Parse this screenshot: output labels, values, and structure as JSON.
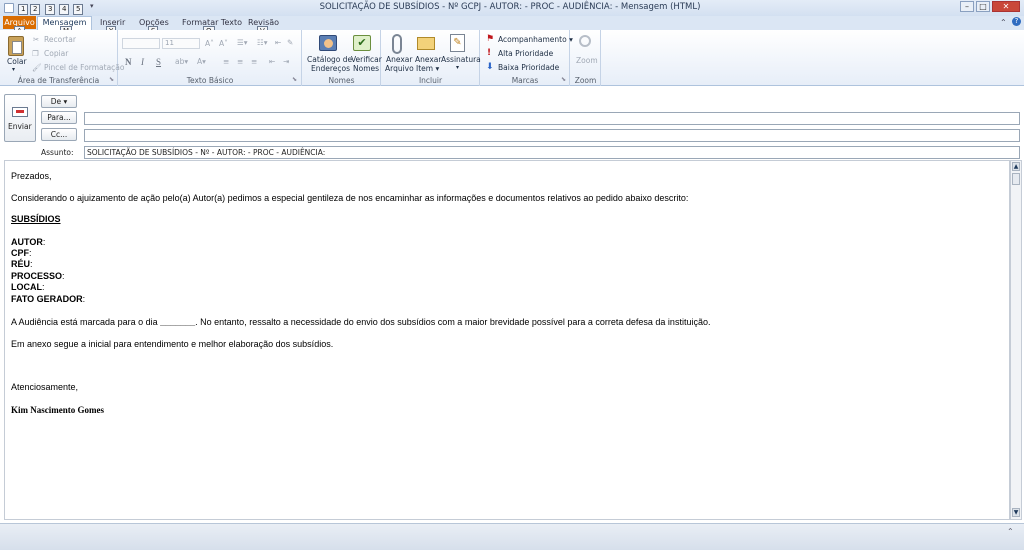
{
  "window": {
    "title": "SOLICITAÇÃO DE SUBSÍDIOS - Nº GCPJ  - AUTOR: - PROC  - AUDIÊNCIA:  - Mensagem (HTML)"
  },
  "quick_access_keytips": [
    "1",
    "2",
    "3",
    "4",
    "5"
  ],
  "tabs": [
    {
      "label": "Arquivo",
      "keytip": "A"
    },
    {
      "label": "Mensagem",
      "keytip": "M"
    },
    {
      "label": "Inserir",
      "keytip": "Y"
    },
    {
      "label": "Opções",
      "keytip": "S"
    },
    {
      "label": "Formatar Texto",
      "keytip": "O"
    },
    {
      "label": "Revisão",
      "keytip": "V"
    }
  ],
  "ribbon": {
    "clipboard": {
      "label": "Área de Transferência",
      "paste": "Colar",
      "cut": "Recortar",
      "copy": "Copiar",
      "format_painter": "Pincel de Formatação"
    },
    "basic_text": {
      "label": "Texto Básico",
      "font_size": "11",
      "bold": "N",
      "italic": "I",
      "underline": "S"
    },
    "names": {
      "label": "Nomes",
      "address_book_line1": "Catálogo de",
      "address_book_line2": "Endereços",
      "check_names_line1": "Verificar",
      "check_names_line2": "Nomes"
    },
    "include": {
      "label": "Incluir",
      "attach_file_line1": "Anexar",
      "attach_file_line2": "Arquivo",
      "attach_item_line1": "Anexar",
      "attach_item_line2": "Item ▾",
      "signature": "Assinatura"
    },
    "tags": {
      "label": "Marcas",
      "follow_up": "Acompanhamento ▾",
      "high_priority": "Alta Prioridade",
      "low_priority": "Baixa Prioridade"
    },
    "zoom": {
      "label": "Zoom",
      "zoom": "Zoom"
    }
  },
  "compose": {
    "send": "Enviar",
    "from": "De ▾",
    "to": "Para...",
    "cc": "Cc...",
    "subject_label": "Assunto:",
    "to_value": "",
    "cc_value": "",
    "subject_value": "SOLICITAÇÃO DE SUBSÍDIOS - Nº  - AUTOR: - PROC  - AUDIÊNCIA:"
  },
  "body": {
    "greeting": "Prezados,",
    "intro": "Considerando o ajuizamento de ação pelo(a) Autor(a) pedimos a especial gentileza de nos encaminhar as informações e documentos relativos ao pedido abaixo descrito:",
    "heading": "SUBSÍDIOS",
    "fields": [
      {
        "label": "AUTOR",
        "sep": ":"
      },
      {
        "label": "CPF",
        "sep": ":"
      },
      {
        "label": "RÉU",
        "sep": ":"
      },
      {
        "label": "PROCESSO",
        "sep": ":"
      },
      {
        "label": "LOCAL",
        "sep": ":"
      },
      {
        "label": "FATO GERADOR",
        "sep": ":"
      }
    ],
    "hearing_pre": "A Audiência está marcada para o dia ",
    "hearing_blank": "_______",
    "hearing_post": ". No entanto, ressalto a necessidade do envio dos subsídios com a maior brevidade possível para a correta defesa da instituição.",
    "attachment_note": "Em anexo segue a inicial para entendimento e melhor elaboração dos subsídios.",
    "closing": "Atenciosamente,",
    "signature": "Kim Nascimento Gomes"
  },
  "colors": {
    "file_tab": "#d96c00",
    "ribbon_text": "#1e395b",
    "high_priority": "#c0161b",
    "low_priority": "#2a64c8"
  }
}
